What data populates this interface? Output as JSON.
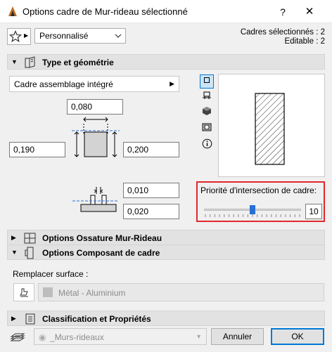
{
  "window": {
    "title": "Options cadre de Mur-rideau sélectionné",
    "help_label": "?",
    "close_label": "✕"
  },
  "header": {
    "preset_value": "Personnalisé",
    "selected_frames": "Cadres sélectionnés : 2",
    "editable": "Editable : 2"
  },
  "sections": {
    "type_geometry": "Type et géométrie",
    "framework_options": "Options Ossature Mur-Rideau",
    "component_options": "Options Composant de cadre",
    "classification": "Classification et Propriétés"
  },
  "geometry": {
    "frame_type": "Cadre assemblage intégré",
    "depth_top": "0,080",
    "offset_left": "0,190",
    "width_right": "0,200",
    "gap": "0,010",
    "bottom": "0,020"
  },
  "view_buttons": [
    "plan-view-icon",
    "section-view-icon",
    "3d-view-icon",
    "filmstrip-icon",
    "info-icon"
  ],
  "priority": {
    "label": "Priorité d'intersection de cadre:",
    "value": "10",
    "level": 0.5,
    "accent": "#e0282c",
    "thumb_color": "#2a6fd6"
  },
  "surface": {
    "replace_label": "Remplacer surface :",
    "material": "Métal - Aluminium"
  },
  "footer": {
    "layer": "_Murs-rideaux",
    "cancel_label": "Annuler",
    "ok_label": "OK"
  }
}
